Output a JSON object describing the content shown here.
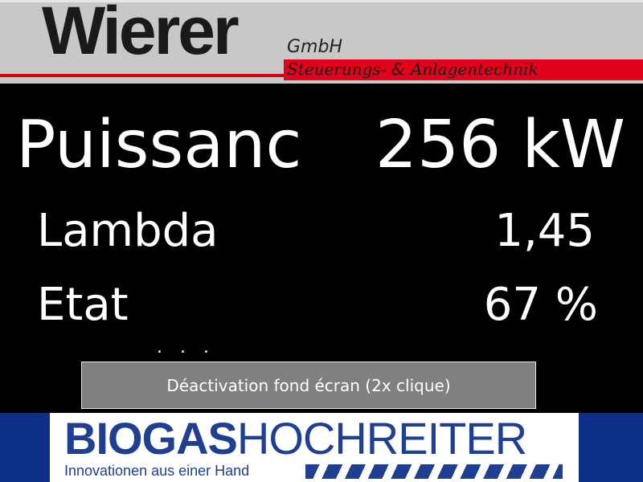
{
  "header": {
    "logo_text": "Wierer",
    "company_suffix": "GmbH",
    "tagline": "Steuerungs- & Anlagentechnik"
  },
  "readings": {
    "power_label": "Puissanc",
    "power_value": "256 kW",
    "lambda_label": "Lambda",
    "lambda_value": "1,45",
    "state_label": "Etat",
    "state_value": "67 %",
    "dots": "..."
  },
  "button": {
    "label": "Déactivation fond écran (2x clique)"
  },
  "footer": {
    "logo_bold": "BIOGAS",
    "logo_thin": "HOCHREITER",
    "slogan": "Innovationen aus einer Hand"
  },
  "colors": {
    "background": "#000000",
    "header_gray": "#c8c8c8",
    "accent_red": "#e3001b",
    "footer_blue": "#0d2f86",
    "button_gray": "#808080"
  }
}
